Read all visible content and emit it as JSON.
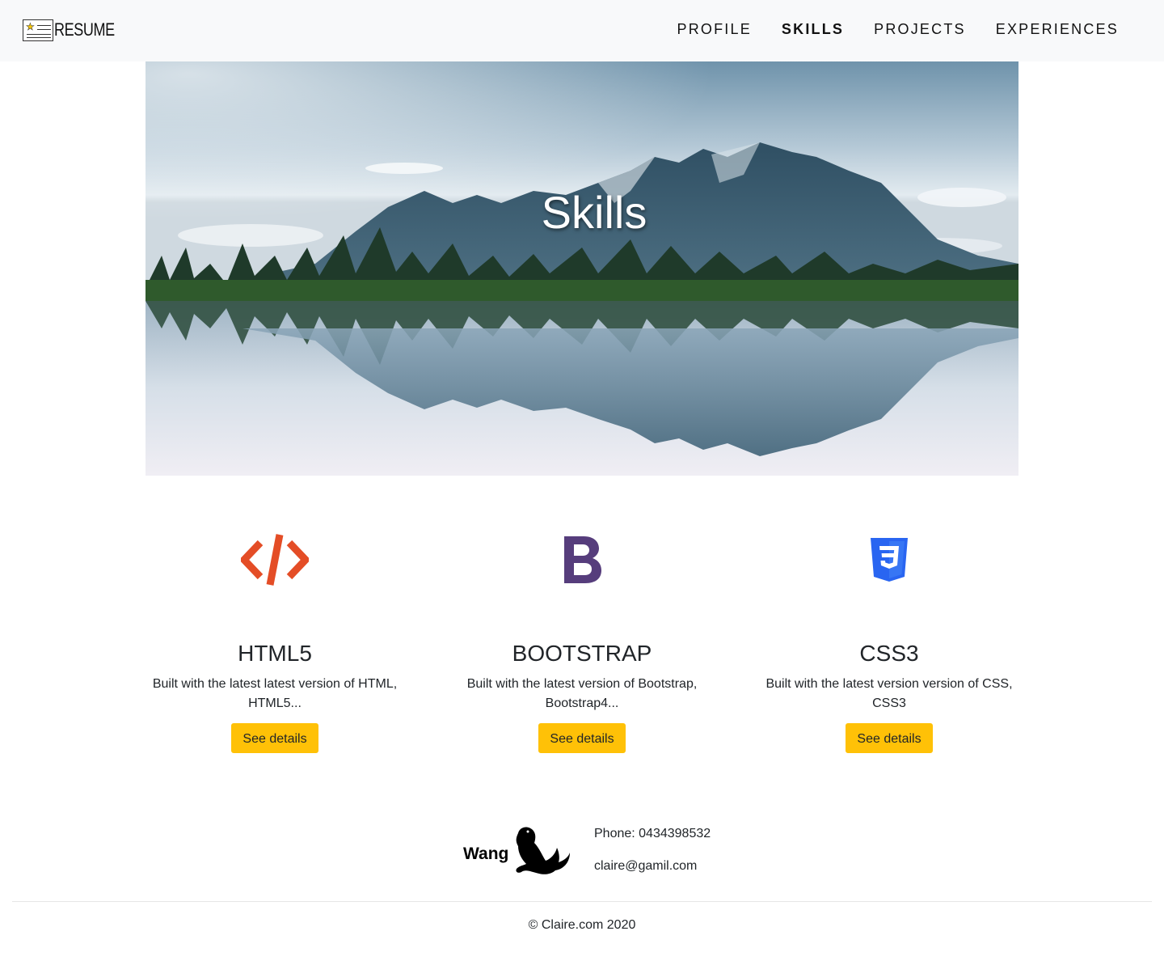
{
  "brand": {
    "text": "RESUME"
  },
  "nav": {
    "items": [
      {
        "label": "PROFILE",
        "active": false
      },
      {
        "label": "SKILLS",
        "active": true
      },
      {
        "label": "PROJECTS",
        "active": false
      },
      {
        "label": "EXPERIENCES",
        "active": false
      }
    ]
  },
  "hero": {
    "title": "Skills"
  },
  "skills": [
    {
      "icon": "html-code-icon",
      "title": "HTML5",
      "description": "Built with the latest latest version of HTML, HTML5...",
      "button": "See details",
      "color": "#e44d26"
    },
    {
      "icon": "bootstrap-icon",
      "title": "BOOTSTRAP",
      "description": "Built with the latest version of Bootstrap, Bootstrap4...",
      "button": "See details",
      "color": "#563d7c"
    },
    {
      "icon": "css3-shield-icon",
      "title": "CSS3",
      "description": "Built with the latest version version of CSS, CSS3",
      "button": "See details",
      "color": "#2965f1"
    }
  ],
  "footer": {
    "logo_text": "Wang",
    "phone": "Phone: 0434398532",
    "email": "claire@gamil.com",
    "copyright": "© Claire.com 2020"
  },
  "colors": {
    "button": "#ffc107",
    "navbar_bg": "#f8f9fa"
  }
}
